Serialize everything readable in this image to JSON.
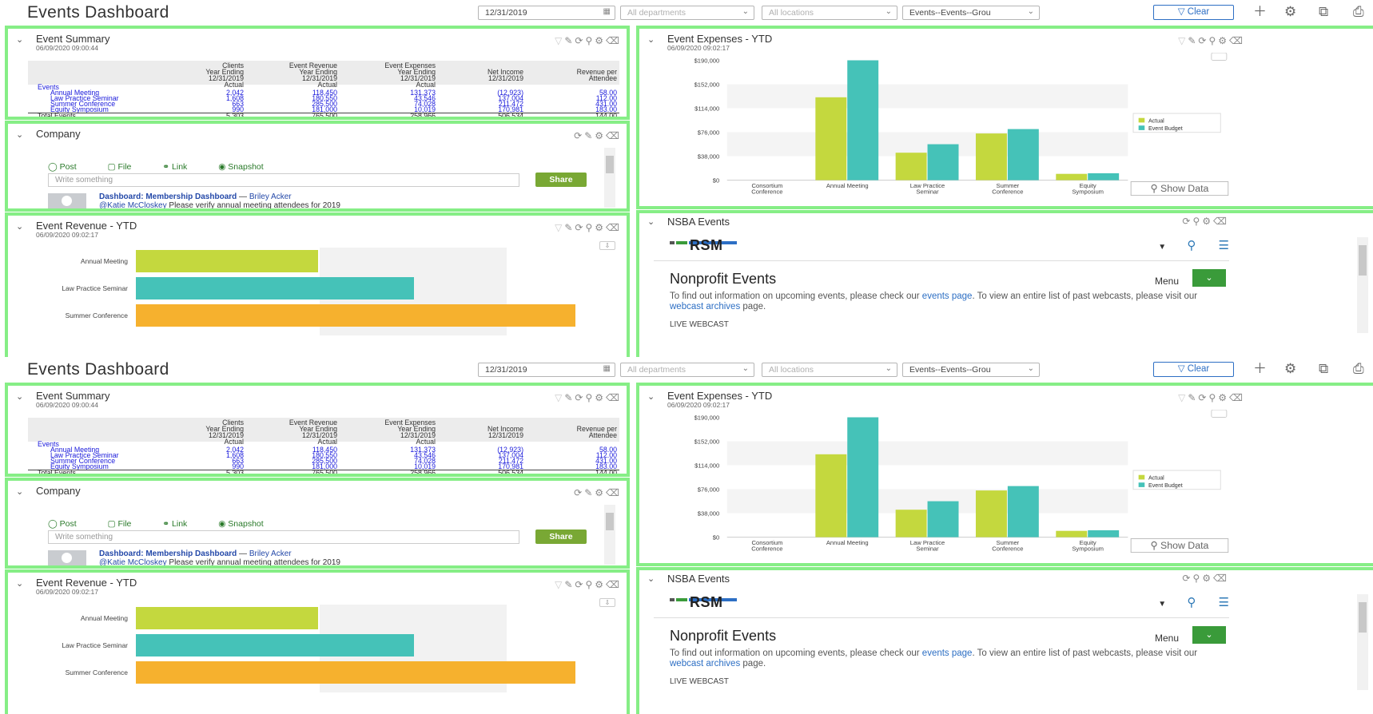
{
  "header": {
    "title": "Events Dashboard",
    "date_filter": "12/31/2019",
    "departments_placeholder": "All departments",
    "locations_placeholder": "All locations",
    "group_filter": "Events--Events--Grou",
    "clear_label": "Clear",
    "icons": [
      "filter-icon",
      "plus-icon",
      "gear-icon",
      "copy-icon",
      "print-icon"
    ]
  },
  "event_summary": {
    "title": "Event Summary",
    "timestamp": "06/09/2020 09:00:44",
    "columns": [
      [
        "Clients",
        "Year Ending",
        "12/31/2019",
        "Actual"
      ],
      [
        "Event Revenue",
        "Year Ending",
        "12/31/2019",
        "Actual"
      ],
      [
        "Event Expenses",
        "Year Ending",
        "12/31/2019",
        "Actual"
      ],
      [
        "Net Income",
        "12/31/2019"
      ],
      [
        "Revenue per",
        "Attendee"
      ]
    ],
    "group_label": "Events",
    "rows": [
      {
        "label": "Annual Meeting",
        "values": [
          "2,042",
          "118,450",
          "131,373",
          "(12,923)",
          "58.00"
        ]
      },
      {
        "label": "Law Practice Seminar",
        "values": [
          "1,608",
          "180,550",
          "43,546",
          "137,004",
          "112.00"
        ]
      },
      {
        "label": "Summer Conference",
        "values": [
          "663",
          "285,500",
          "74,028",
          "211,472",
          "431.00"
        ]
      },
      {
        "label": "Equity Symposium",
        "values": [
          "990",
          "181,000",
          "10,019",
          "170,981",
          "183.00"
        ]
      }
    ],
    "total": {
      "label": "Total Events",
      "values": [
        "5,303",
        "765,500",
        "258,966",
        "506,534",
        "144.00"
      ]
    }
  },
  "company": {
    "title": "Company",
    "actions": [
      "Post",
      "File",
      "Link",
      "Snapshot"
    ],
    "placeholder": "Write something",
    "share_label": "Share",
    "feed": {
      "dashboard": "Dashboard: Membership Dashboard",
      "separator": " — ",
      "author": "Briley Acker",
      "mention": "@Katie McCloskey",
      "message": " Please verify annual meeting attendees for 2019"
    }
  },
  "event_revenue": {
    "title": "Event Revenue - YTD",
    "timestamp": "06/09/2020 09:02:17"
  },
  "event_expenses": {
    "title": "Event Expenses - YTD",
    "timestamp": "06/09/2020 09:02:17",
    "show_data_label": "Show Data"
  },
  "nsba": {
    "title": "NSBA Events",
    "brand": "RSM",
    "heading": "Nonprofit Events",
    "menu_label": "Menu",
    "text_1": "To find out information on upcoming events, please check our ",
    "link_1": "events page",
    "text_2": ". To view an entire list of past webcasts, please visit our ",
    "link_2": "webcast archives",
    "text_3": " page.",
    "live": "LIVE WEBCAST"
  },
  "chart_data": [
    {
      "type": "bar",
      "orientation": "horizontal",
      "title": "Event Revenue - YTD",
      "categories": [
        "Annual Meeting",
        "Law Practice Seminar",
        "Summer Conference"
      ],
      "values": [
        118450,
        180550,
        285500
      ],
      "colors": [
        "#c4d83e",
        "#45c2b8",
        "#f6b12e"
      ]
    },
    {
      "type": "bar",
      "title": "Event Expenses - YTD",
      "categories": [
        "Consortium Conference",
        "Annual Meeting",
        "Law Practice Seminar",
        "Summer Conference",
        "Equity Symposium"
      ],
      "series": [
        {
          "name": "Actual",
          "values": [
            0,
            131373,
            43546,
            74028,
            10019
          ],
          "color": "#c4d83e"
        },
        {
          "name": "Event Budget",
          "values": [
            0,
            190000,
            57000,
            81000,
            11000
          ],
          "color": "#45c2b8"
        }
      ],
      "ylim": [
        0,
        190000
      ],
      "yticks": [
        "$0",
        "$38,000",
        "$76,000",
        "$114,000",
        "$152,000",
        "$190,000"
      ],
      "legend": "right"
    }
  ]
}
